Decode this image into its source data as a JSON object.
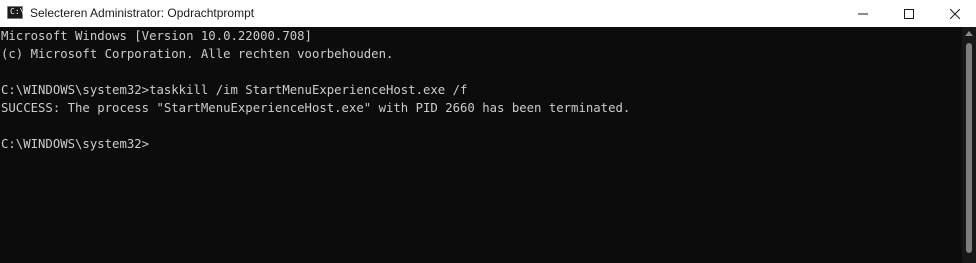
{
  "window": {
    "title": "Selecteren Administrator: Opdrachtprompt",
    "icon": "cmd-icon",
    "icon_glyph": "C:\\",
    "controls": {
      "minimize": "minimize-icon",
      "maximize": "maximize-icon",
      "close": "close-icon"
    }
  },
  "terminal": {
    "lines": [
      "Microsoft Windows [Version 10.0.22000.708]",
      "(c) Microsoft Corporation. Alle rechten voorbehouden.",
      "C:\\WINDOWS\\system32>taskkill /im StartMenuExperienceHost.exe /f",
      "SUCCESS: The process \"StartMenuExperienceHost.exe\" with PID 2660 has been terminated.",
      "C:\\WINDOWS\\system32>"
    ]
  },
  "colors": {
    "terminal_background": "#0c0c0c",
    "terminal_text": "#cccccc",
    "titlebar_background": "#ffffff"
  }
}
